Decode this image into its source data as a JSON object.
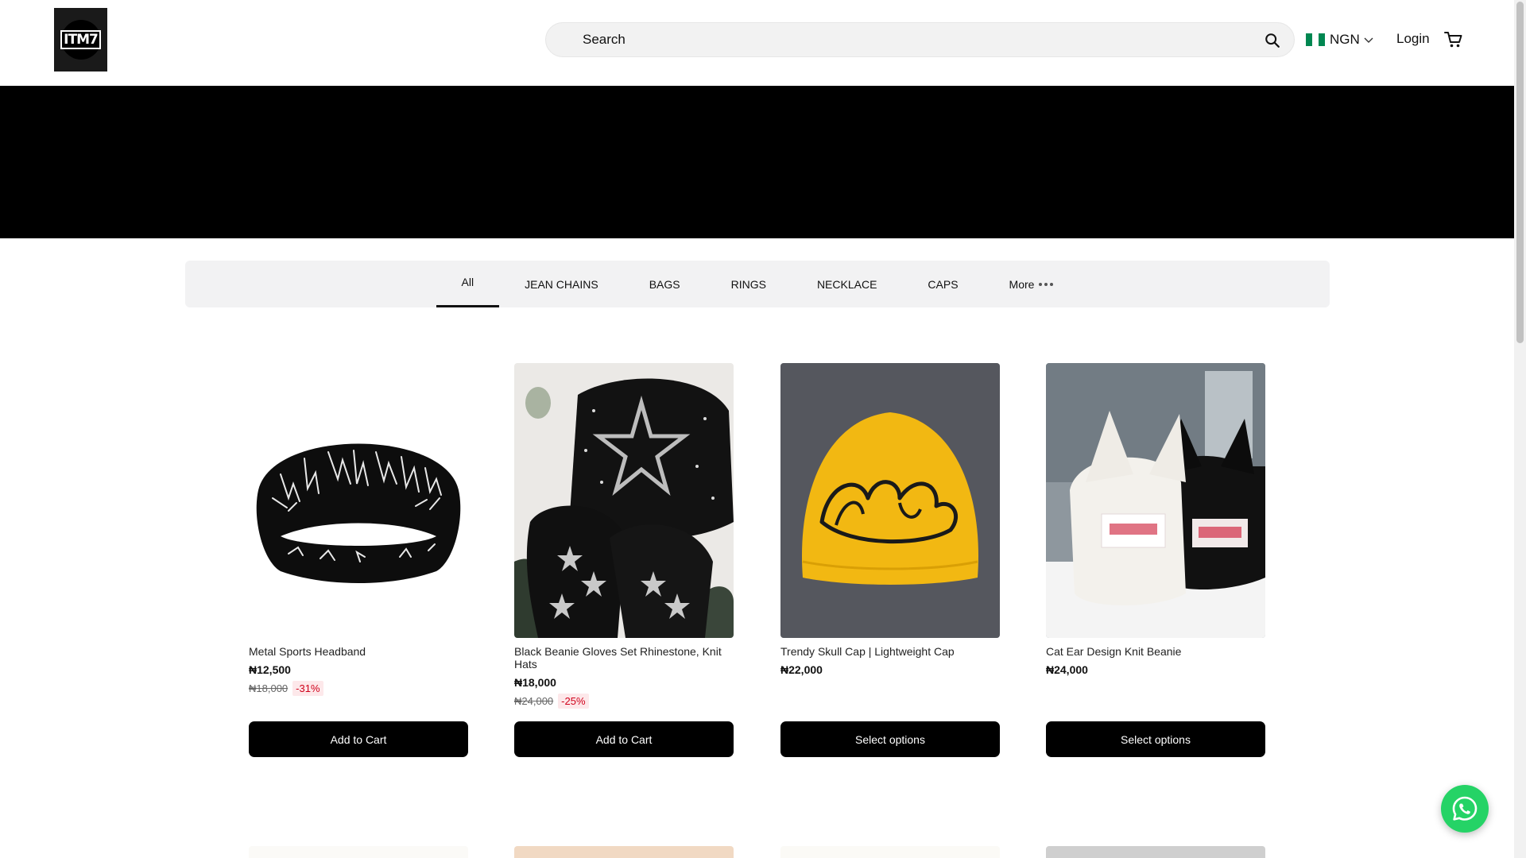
{
  "header": {
    "logo_text": "ITM7",
    "search": {
      "placeholder": "Search",
      "value": ""
    },
    "currency": {
      "label": "NGN",
      "flag_colors": [
        "#008751",
        "#ffffff",
        "#008751"
      ]
    },
    "login_label": "Login",
    "cart_icon": "cart-icon"
  },
  "banner": {
    "color": "#000000"
  },
  "tabs": {
    "items": [
      {
        "label": "All",
        "active": true
      },
      {
        "label": "JEAN CHAINS",
        "active": false
      },
      {
        "label": "BAGS",
        "active": false
      },
      {
        "label": "RINGS",
        "active": false
      },
      {
        "label": "NECKLACE",
        "active": false
      },
      {
        "label": "CAPS",
        "active": false
      },
      {
        "label": "More",
        "active": false
      }
    ]
  },
  "products": [
    {
      "name": "Metal Sports Headband",
      "price": "₦12,500",
      "old_price": "₦18,000",
      "discount": "-31%",
      "cta": "Add to Cart"
    },
    {
      "name": "Black Beanie Gloves Set Rhinestone, Knit Hats",
      "price": "₦18,000",
      "old_price": "₦24,000",
      "discount": "-25%",
      "cta": "Add to Cart"
    },
    {
      "name": "Trendy Skull Cap | Lightweight Cap",
      "price": "₦22,000",
      "old_price": "",
      "discount": "",
      "cta": "Select options"
    },
    {
      "name": "Cat Ear Design Knit Beanie",
      "price": "₦24,000",
      "old_price": "",
      "discount": "",
      "cta": "Select options"
    }
  ],
  "colors": {
    "accent": "#000000",
    "discount": "#d0021b",
    "whatsapp": "#25d366"
  }
}
